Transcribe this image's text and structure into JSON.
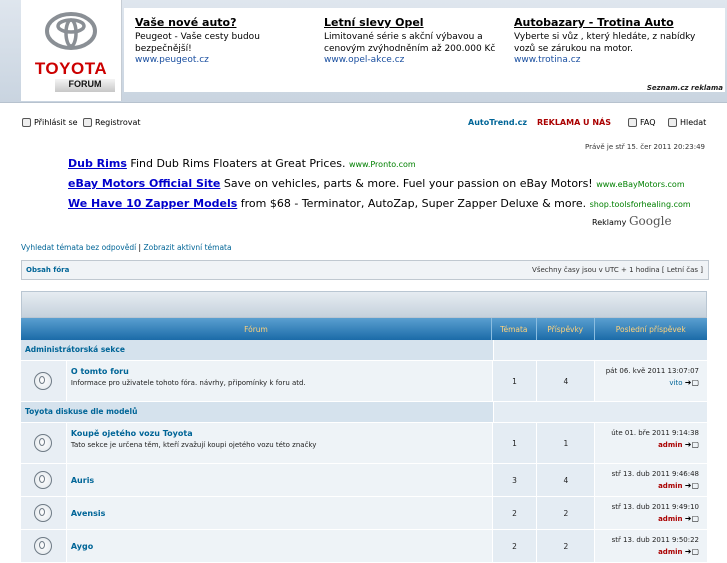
{
  "header": {
    "logo_brand": "TOYOTA",
    "logo_sub": "FORUM",
    "ads": [
      {
        "title": "Vaše nové auto?",
        "desc": "Peugeot - Vaše cesty budou bezpečnější!",
        "url": "www.peugeot.cz"
      },
      {
        "title": "Letní slevy Opel",
        "desc": "Limitované série s akční výbavou a cenovým zvýhodněním až 200.000 Kč",
        "url": "www.opel-akce.cz"
      },
      {
        "title": "Autobazary - Trotina Auto",
        "desc": "Vyberte si vůz , který hledáte, z nabídky vozů se zárukou na motor.",
        "url": "www.trotina.cz"
      }
    ],
    "ad_badge": "Seznam.cz reklama"
  },
  "nav": {
    "login": "Přihlásit se",
    "register": "Registrovat",
    "autotrend": "AutoTrend.cz",
    "reklama": "REKLAMA U NÁS",
    "faq": "FAQ",
    "search": "Hledat",
    "date": "Právě je stř 15. čer 2011 20:23:49"
  },
  "google_ads": [
    {
      "title": "Dub Rims",
      "text": " Find Dub Rims Floaters at Great Prices. ",
      "url": "www.Pronto.com"
    },
    {
      "title": "eBay Motors Official Site",
      "text": " Save on vehicles, parts & more. Fuel your passion on eBay Motors! ",
      "url": "www.eBayMotors.com"
    },
    {
      "title": "We Have 10 Zapper Models",
      "text": " from $68 - Terminator, AutoZap, Super Zapper Deluxe & more. ",
      "url": "shop.toolsforhealing.com"
    }
  ],
  "google_label": "Reklamy",
  "google_brand": "Google",
  "links": {
    "unanswered": "Vyhledat témata bez odpovědí",
    "sep": " | ",
    "active": "Zobrazit aktivní témata"
  },
  "crumb": {
    "left": "Obsah fóra",
    "right": "Všechny časy jsou v UTC + 1 hodina [ Letní čas ]"
  },
  "table": {
    "headers": [
      "Fórum",
      "Témata",
      "Příspěvky",
      "Poslední příspěvek"
    ],
    "categories": [
      {
        "name": "Administrátorská sekce"
      },
      {
        "name": "Toyota diskuse dle modelů"
      }
    ],
    "forums": [
      {
        "name": "O tomto foru",
        "desc": "Informace pro uživatele tohoto fóra. návrhy, připomínky k foru atd.",
        "topics": "1",
        "posts": "4",
        "last_date": "pát 06. kvě 2011 13:07:07",
        "last_author": "vito"
      },
      {
        "name": "Koupě ojetého vozu Toyota",
        "desc": "Tato sekce je určena těm, kteří zvažují koupi ojetého vozu této značky",
        "topics": "1",
        "posts": "1",
        "last_date": "úte 01. bře 2011 9:14:38",
        "last_author": "admin"
      },
      {
        "name": "Auris",
        "desc": "",
        "topics": "3",
        "posts": "4",
        "last_date": "stř 13. dub 2011 9:46:48",
        "last_author": "admin"
      },
      {
        "name": "Avensis",
        "desc": "",
        "topics": "2",
        "posts": "2",
        "last_date": "stř 13. dub 2011 9:49:10",
        "last_author": "admin"
      },
      {
        "name": "Aygo",
        "desc": "",
        "topics": "2",
        "posts": "2",
        "last_date": "stř 13. dub 2011 9:50:22",
        "last_author": "admin"
      }
    ]
  }
}
